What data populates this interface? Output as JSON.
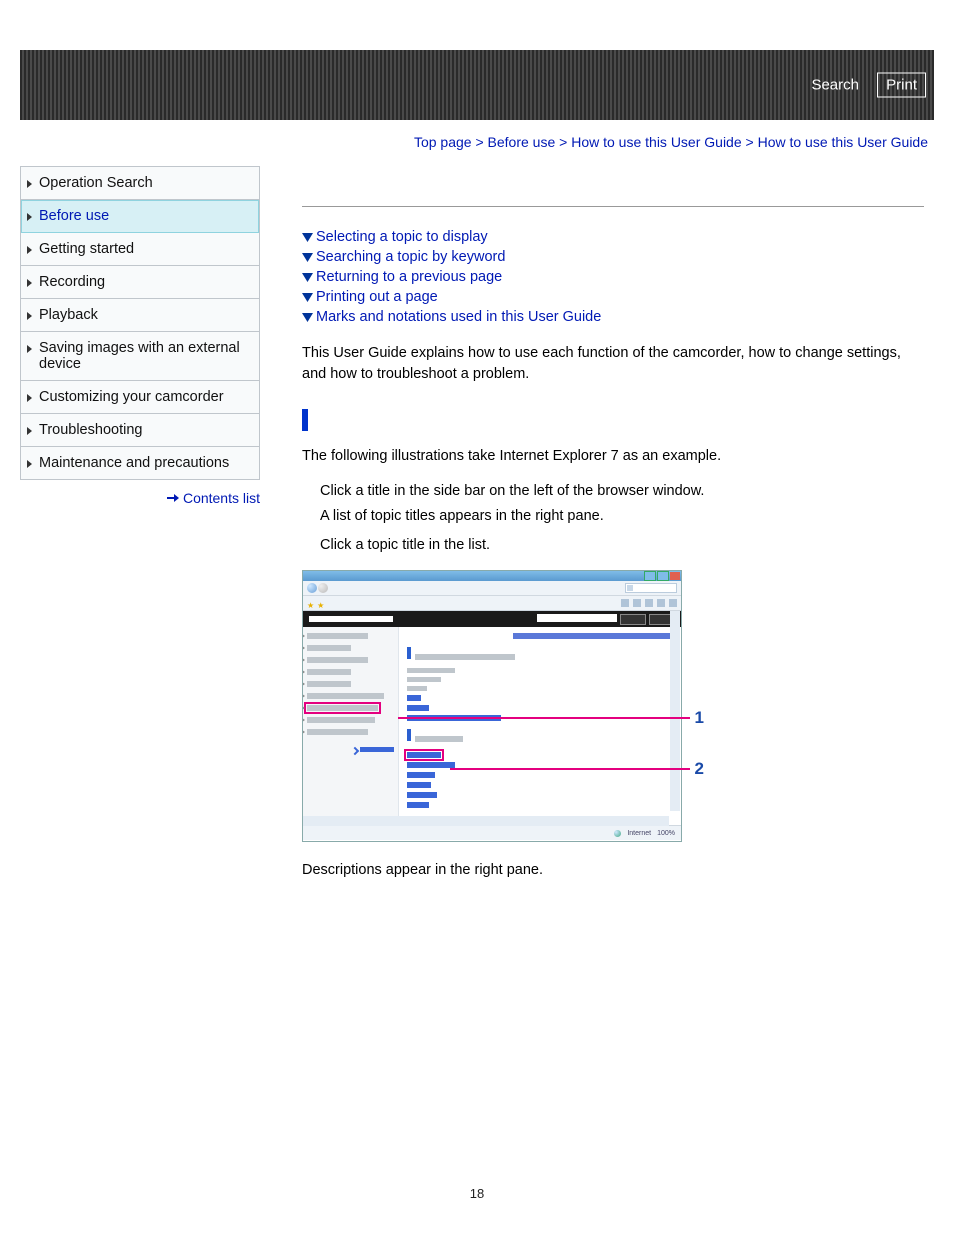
{
  "topbar": {
    "search": "Search",
    "print": "Print"
  },
  "breadcrumb": {
    "items": [
      "Top page",
      "Before use",
      "How to use this User Guide"
    ],
    "current": "How to use this User Guide",
    "sep": " > "
  },
  "sidebar": {
    "items": [
      {
        "label": "Operation Search"
      },
      {
        "label": "Before use",
        "active": true
      },
      {
        "label": "Getting started"
      },
      {
        "label": "Recording"
      },
      {
        "label": "Playback"
      },
      {
        "label": "Saving images with an external device"
      },
      {
        "label": "Customizing your camcorder"
      },
      {
        "label": "Troubleshooting"
      },
      {
        "label": "Maintenance and precautions"
      }
    ],
    "contents_link": "Contents list"
  },
  "anchors": [
    "Selecting a topic to display",
    "Searching a topic by keyword",
    "Returning to a previous page",
    "Printing out a page",
    "Marks and notations used in this User Guide"
  ],
  "intro": "This User Guide explains how to use each function of the camcorder, how to change settings, and how to troubleshoot a problem.",
  "example_note": "The following illustrations take Internet Explorer 7 as an example.",
  "steps": [
    "Click a title in the side bar on the left of the browser window.",
    "A list of topic titles appears in the right pane.",
    "Click a topic title in the list."
  ],
  "after_fig": "Descriptions appear in the right pane.",
  "illustration": {
    "status_text": "Internet",
    "zoom_text": "100%",
    "callouts": [
      "1",
      "2"
    ]
  },
  "page_number": "18"
}
